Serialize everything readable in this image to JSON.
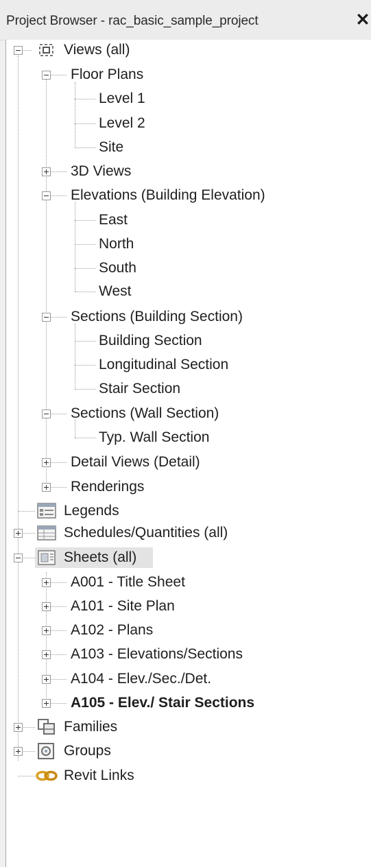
{
  "panel": {
    "title": "Project Browser - rac_basic_sample_project",
    "close_glyph": "✕"
  },
  "tree": {
    "views": {
      "label": "Views (all)",
      "icon": "views-icon",
      "floor_plans": {
        "label": "Floor Plans",
        "items": [
          "Level 1",
          "Level 2",
          "Site"
        ]
      },
      "views_3d": {
        "label": "3D Views"
      },
      "elevations": {
        "label": "Elevations (Building Elevation)",
        "items": [
          "East",
          "North",
          "South",
          "West"
        ]
      },
      "sections_building": {
        "label": "Sections (Building Section)",
        "items": [
          "Building Section",
          "Longitudinal Section",
          "Stair Section"
        ]
      },
      "sections_wall": {
        "label": "Sections (Wall Section)",
        "items": [
          "Typ. Wall Section"
        ]
      },
      "detail_views": {
        "label": "Detail Views (Detail)"
      },
      "renderings": {
        "label": "Renderings"
      }
    },
    "legends": {
      "label": "Legends",
      "icon": "legend-icon"
    },
    "schedules": {
      "label": "Schedules/Quantities (all)",
      "icon": "schedule-icon"
    },
    "sheets": {
      "label": "Sheets (all)",
      "icon": "sheet-icon",
      "items": [
        "A001 - Title Sheet",
        "A101 - Site Plan",
        "A102 - Plans",
        "A103 - Elevations/Sections",
        "A104 - Elev./Sec./Det.",
        "A105 - Elev./ Stair Sections"
      ],
      "active_item": "A105 - Elev./ Stair Sections"
    },
    "families": {
      "label": "Families",
      "icon": "families-icon"
    },
    "groups": {
      "label": "Groups",
      "icon": "groups-icon"
    },
    "revit_links": {
      "label": "Revit Links",
      "icon": "revit-link-icon"
    }
  }
}
